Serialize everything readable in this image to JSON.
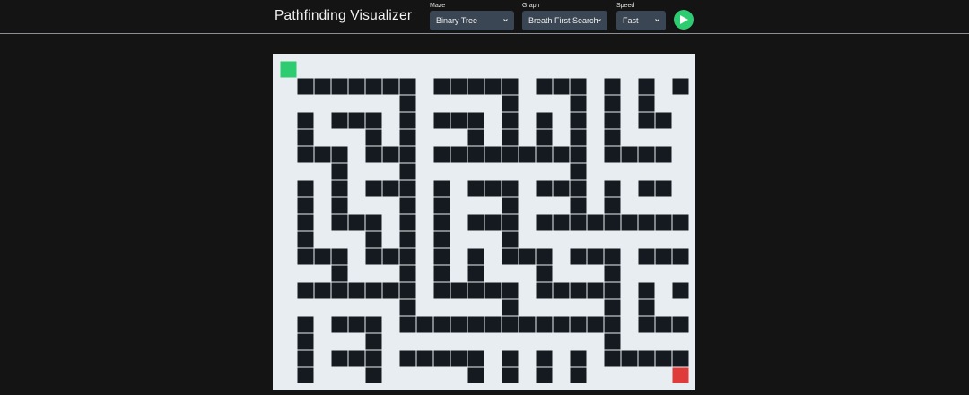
{
  "header": {
    "title": "Pathfinding Visualizer"
  },
  "controls": {
    "maze": {
      "label": "Maze",
      "value": "Binary Tree"
    },
    "graph": {
      "label": "Graph",
      "value": "Breath First Search"
    },
    "speed": {
      "label": "Speed",
      "value": "Fast"
    },
    "run_icon": "play-icon"
  },
  "colors": {
    "background": "#141414",
    "select_bg": "#3a4653",
    "run_button": "#2ecc71",
    "open_cell": "#e8edf2",
    "wall": "#141a1f",
    "start_node": "#2ecc71",
    "end_node": "#e03b3b"
  },
  "grid": {
    "rows": 19,
    "cols": 24,
    "start": [
      0,
      0
    ],
    "end": [
      18,
      23
    ]
  }
}
